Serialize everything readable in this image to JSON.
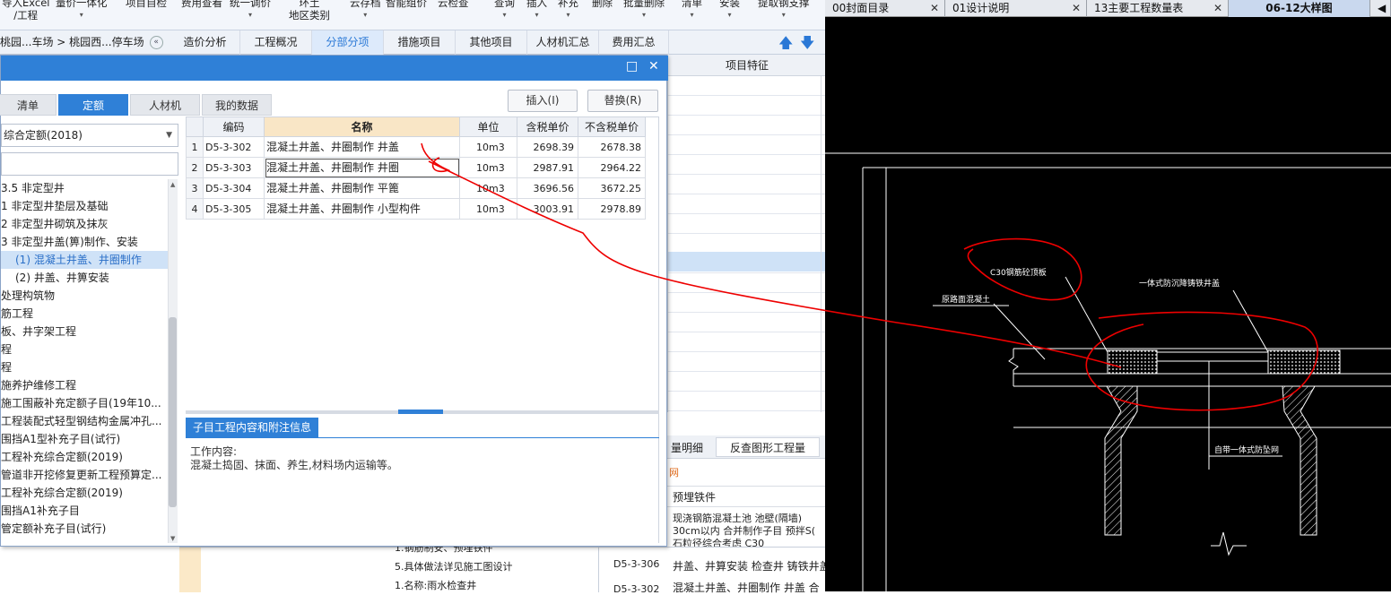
{
  "toolbar": {
    "items": [
      {
        "label": "导入Excel",
        "label2": "/工程",
        "caret": false
      },
      {
        "label": "量价一体化",
        "caret": true
      },
      {
        "label": "项目自检",
        "caret": false
      },
      {
        "label": "费用查看",
        "caret": false
      },
      {
        "label": "统一调价",
        "caret": true
      },
      {
        "label": "环土",
        "label2": "地区类别",
        "caret": false
      },
      {
        "label": "云存档",
        "caret": true
      },
      {
        "label": "智能组价",
        "caret": false
      },
      {
        "label": "云检查",
        "caret": false
      },
      {
        "label": "查询",
        "caret": true
      },
      {
        "label": "插入",
        "caret": true
      },
      {
        "label": "补充",
        "caret": true
      },
      {
        "label": "删除",
        "caret": false
      },
      {
        "label": "批量删除",
        "caret": true
      },
      {
        "label": "清单",
        "caret": true
      },
      {
        "label": "安装",
        "caret": true
      },
      {
        "label": "提取钢支撑",
        "caret": true
      }
    ]
  },
  "breadcrumb": {
    "text": "桃园...车场 > 桃园西...停车场",
    "toggle": "«"
  },
  "main_tabs": [
    {
      "label": "造价分析"
    },
    {
      "label": "工程概况"
    },
    {
      "label": "分部分项"
    },
    {
      "label": "措施项目"
    },
    {
      "label": "其他项目"
    },
    {
      "label": "人材机汇总"
    },
    {
      "label": "费用汇总"
    }
  ],
  "nav": {
    "up": "🡅",
    "down": "🡇"
  },
  "bg_panel": {
    "header": "项目特征"
  },
  "dialog": {
    "controls": {
      "maximize": "□",
      "close": "✕"
    },
    "tabs": [
      {
        "label": "清单"
      },
      {
        "label": "定额"
      },
      {
        "label": "人材机"
      },
      {
        "label": "我的数据"
      }
    ],
    "insert_button": "插入(I)",
    "replace_button": "替换(R)",
    "library": "综合定额(2018)",
    "tree": [
      "3.5 非定型井",
      "1 非定型井垫层及基础",
      "2 非定型井砌筑及抹灰",
      "3 非定型井盖(箅)制作、安装",
      "(1) 混凝土井盖、井圈制作",
      "(2) 井盖、井箅安装",
      "处理构筑物",
      "筋工程",
      "板、井字架工程",
      "程",
      "程",
      "施养护维修工程",
      "施工围蔽补充定额子目(19年10...",
      "工程装配式轻型钢结构金属冲孔...",
      "围挡A1型补充子目(试行)",
      "工程补充综合定额(2019)",
      "管道非开挖修复更新工程预算定...",
      "工程补充综合定额(2019)",
      "围挡A1补充子目",
      "管定额补充子目(试行)"
    ],
    "grid": {
      "headers": {
        "idx": "",
        "code": "编码",
        "name": "名称",
        "unit": "单位",
        "tax": "含税单价",
        "notax": "不含税单价"
      },
      "rows": [
        {
          "idx": "1",
          "code": "D5-3-302",
          "name": "混凝土井盖、井圈制作 井盖",
          "unit": "10m3",
          "tax": "2698.39",
          "notax": "2678.38"
        },
        {
          "idx": "2",
          "code": "D5-3-303",
          "name": "混凝土井盖、井圈制作 井圈",
          "unit": "10m3",
          "tax": "2987.91",
          "notax": "2964.22"
        },
        {
          "idx": "3",
          "code": "D5-3-304",
          "name": "混凝土井盖、井圈制作 平篦",
          "unit": "10m3",
          "tax": "3696.56",
          "notax": "3672.25"
        },
        {
          "idx": "4",
          "code": "D5-3-305",
          "name": "混凝土井盖、井圈制作 小型构件",
          "unit": "10m3",
          "tax": "3003.91",
          "notax": "2978.89"
        }
      ]
    },
    "info_tab": "子目工程内容和附注信息",
    "info_lines": [
      "工作内容:",
      "混凝土捣固、抹面、养生,材料场内运输等。"
    ]
  },
  "lower_sheet": {
    "tabs": [
      "量明细",
      "反查图形工程量"
    ],
    "red_label": "网",
    "header": "预埋铁件",
    "desc_lines": [
      "现浇钢筋混凝土池 池壁(隔墙)",
      "30cm以内  合并制作子目 预拌S(",
      "石粒径综合考虑 C30"
    ],
    "rows": [
      {
        "feature": "5.具体做法详见施工图设计",
        "code": "D5-3-306",
        "name": "井盖、井算安装 检查井 铸铁井盖"
      },
      {
        "feature": "1.名称:雨水检查井",
        "code": "D5-3-302",
        "name": "混凝土井盖、井圈制作 井盖  合"
      },
      {
        "feature": "1.钢筋制安、预埋铁件"
      }
    ]
  },
  "cad": {
    "tabs": [
      {
        "label": "00封面目录"
      },
      {
        "label": "01设计说明"
      },
      {
        "label": "13主要工程数量表"
      },
      {
        "label": "06-12大样图"
      },
      {
        "label": "◀"
      }
    ],
    "labels": {
      "c30": "C30钢筋砼顶板",
      "frame": "一体式防沉降铸铁井盖",
      "road": "原路面混凝土",
      "net": "自带一体式防坠网"
    }
  }
}
